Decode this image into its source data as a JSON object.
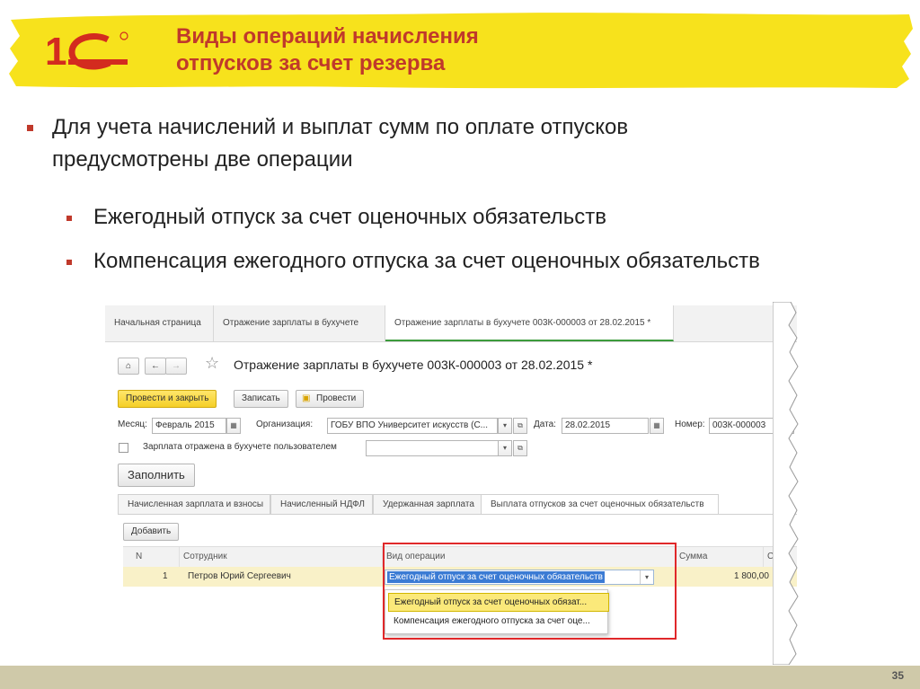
{
  "header": {
    "title_line1": "Виды операций начисления",
    "title_line2": "отпусков за счет резерва",
    "colors": {
      "highlight": "#f7e21c",
      "title": "#c0392b",
      "logo_red": "#d32b1f"
    }
  },
  "body": {
    "bullet_main_line1": "Для учета начислений и выплат сумм по оплате отпусков",
    "bullet_main_line2": "предусмотрены две операции",
    "sub_bullets": [
      "Ежегодный отпуск за счет оценочных обязательств",
      "Компенсация ежегодного отпуска за счет оценочных обязательств"
    ]
  },
  "app": {
    "tabs": [
      "Начальная страница",
      "Отражение зарплаты в бухучете",
      "Отражение зарплаты в бухучете 003К-000003 от 28.02.2015 *"
    ],
    "doc_title": "Отражение зарплаты в бухучете 003К-000003 от 28.02.2015 *",
    "nav": {
      "home_icon": "home-icon",
      "back_icon": "arrow-left-icon",
      "forward_icon": "arrow-right-icon",
      "star_icon": "star-icon"
    },
    "toolbar": {
      "post_close": "Провести и закрыть",
      "save": "Записать",
      "post": "Провести"
    },
    "form": {
      "month_label": "Месяц:",
      "month_value": "Февраль 2015",
      "org_label": "Организация:",
      "org_value": "ГОБУ ВПО Университет искусств (С...",
      "date_label": "Дата:",
      "date_value": "28.02.2015",
      "number_label": "Номер:",
      "number_value": "003К-000003",
      "checkbox_label": "Зарплата отражена в бухучете пользователем",
      "fill_button": "Заполнить"
    },
    "form_tabs": [
      "Начисленная зарплата и взносы",
      "Начисленный НДФЛ",
      "Удержанная зарплата",
      "Выплата отпусков за счет оценочных обязательств"
    ],
    "add_button": "Добавить",
    "table": {
      "columns": [
        "N",
        "Сотрудник",
        "Вид операции",
        "Сумма",
        "С"
      ],
      "rows": [
        {
          "n": "1",
          "employee": "Петров Юрий Сергеевич",
          "operation": "Ежегодный отпуск за счет оценочных обязательств",
          "sum": "1 800,00"
        }
      ]
    },
    "dropdown_options": [
      "Ежегодный отпуск за счет оценочных обязат...",
      "Компенсация ежегодного отпуска за счет оце..."
    ]
  },
  "footer": {
    "page_number": "35"
  }
}
